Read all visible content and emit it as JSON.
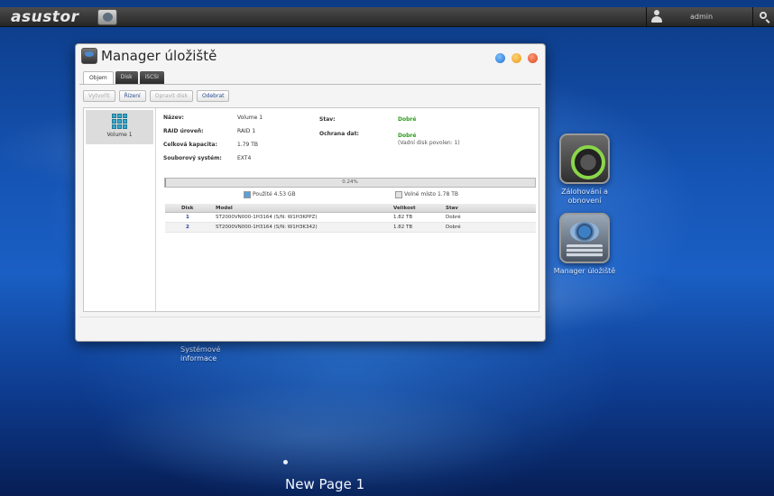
{
  "topbar": {
    "brand": "asustor",
    "user": "admin"
  },
  "desktop_icons": {
    "backup": {
      "label_line1": "Zálohování a",
      "label_line2": "obnovení",
      "icon": "backup-icon"
    },
    "storage": {
      "label": "Manager úložiště",
      "icon": "storage-manager-icon"
    },
    "sysinfo": {
      "label_line1": "Systémové",
      "label_line2": "informace"
    }
  },
  "pager": {
    "label": "New Page 1"
  },
  "window": {
    "title": "Manager úložiště",
    "tabs": [
      "Objem",
      "Disk",
      "iSCSI"
    ],
    "toolbar": [
      "Vytvořit",
      "Řízení",
      "Opravit disk",
      "Odebrat"
    ],
    "volume": {
      "name": "Volume 1"
    },
    "info": {
      "name_label": "Název:",
      "name_value": "Volume 1",
      "raid_label": "RAID úroveň:",
      "raid_value": "RAID 1",
      "capacity_label": "Celková kapacita:",
      "capacity_value": "1.79 TB",
      "fs_label": "Souborový systém:",
      "fs_value": "EXT4",
      "status_label": "Stav:",
      "status_value": "Dobré",
      "protection_label": "Ochrana dat:",
      "protection_value": "Dobré",
      "protection_note": "(Vadní disk povolen: 1)"
    },
    "usage": {
      "percent_text": "0.24%",
      "percent": 0.24,
      "used_label": "Použité 4.53 GB",
      "free_label": "Volné místo 1.78 TB",
      "used_color": "#5aa0d8",
      "free_color": "#e2e2e2"
    },
    "disk_table": {
      "headers": [
        "Disk",
        "Model",
        "Velikost",
        "Stav"
      ],
      "rows": [
        {
          "disk": "1",
          "model": "ST2000VN000-1H3164 (S/N: W1H3KPPZ)",
          "size": "1.82 TB",
          "status": "Dobré"
        },
        {
          "disk": "2",
          "model": "ST2000VN000-1H3164 (S/N: W1H3K342)",
          "size": "1.82 TB",
          "status": "Dobré"
        }
      ]
    }
  }
}
